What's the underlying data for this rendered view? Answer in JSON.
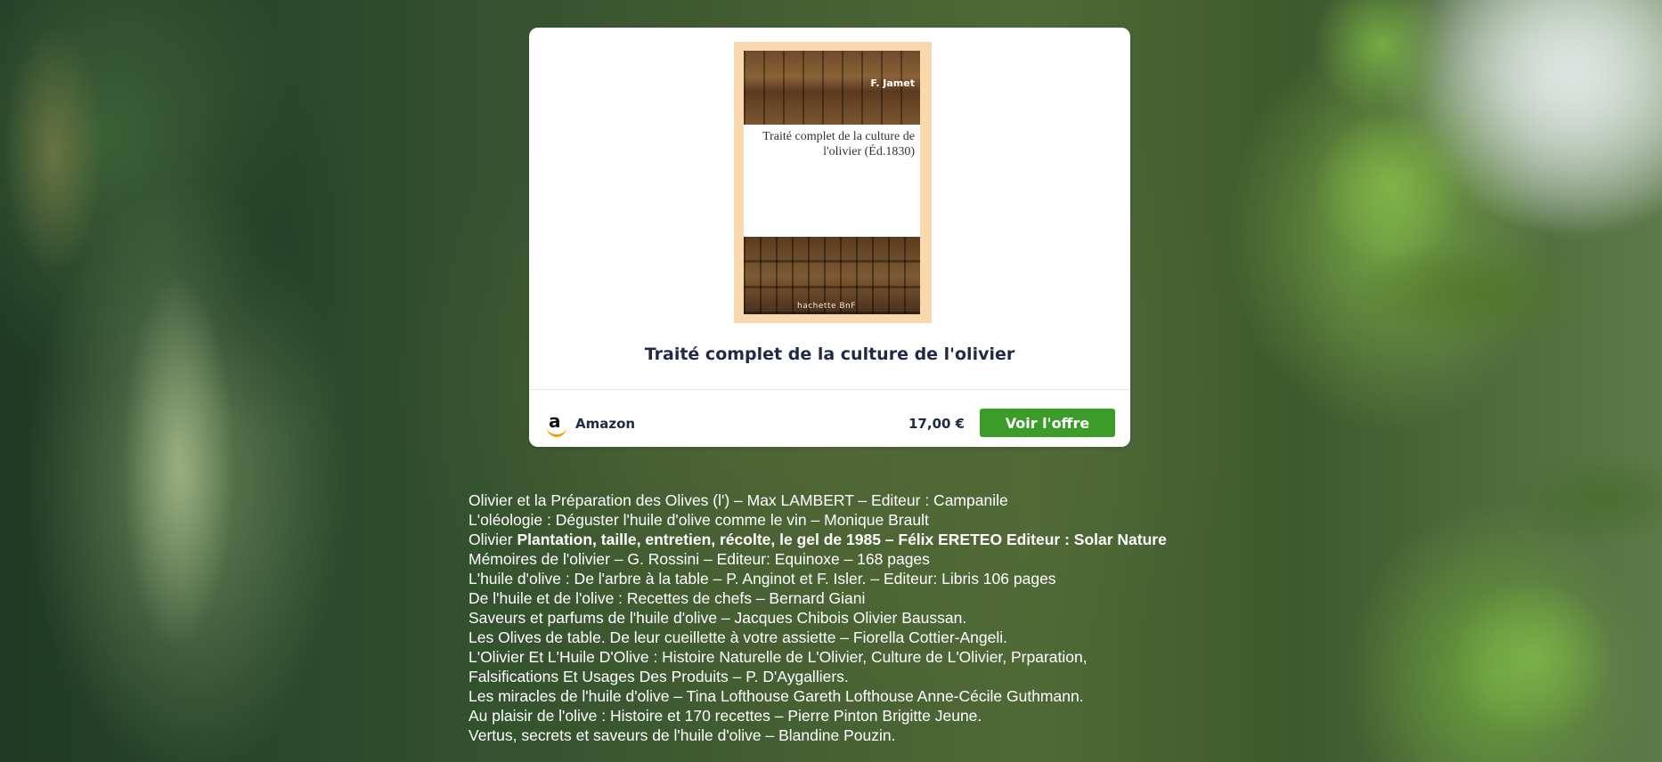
{
  "product_card": {
    "cover": {
      "author": "F. Jamet",
      "title": "Traité complet de la culture de l'olivier (Éd.1830)",
      "publisher": "hachette BnF"
    },
    "title": "Traité complet de la culture de l'olivier",
    "merchant": {
      "icon": "amazon-logo-icon",
      "name": "Amazon"
    },
    "price": "17,00 €",
    "offer_button_label": "Voir l'offre",
    "accent_color": "#3b9c2a"
  },
  "book_list": [
    {
      "text": "Olivier et la Préparation des Olives (l') – Max LAMBERT – Editeur : Campanile"
    },
    {
      "text": "L'oléologie : Déguster l'huile d'olive comme le vin – Monique Brault"
    },
    {
      "prefix": "Olivier ",
      "bold": "Plantation, taille, entretien, récolte, le gel de 1985 – Félix ERETEO Editeur : Solar Nature"
    },
    {
      "text": "Mémoires de l'olivier – G. Rossini – Editeur: Equinoxe – 168 pages"
    },
    {
      "text": "L'huile d'olive : De l'arbre à la table – P. Anginot et F. Isler. – Editeur: Libris 106 pages"
    },
    {
      "text": "De l'huile et de l'olive : Recettes de chefs – Bernard Giani"
    },
    {
      "text": "Saveurs et parfums de l'huile d'olive – Jacques Chibois Olivier Baussan."
    },
    {
      "text": "Les Olives de table. De leur cueillette à votre assiette – Fiorella Cottier-Angeli."
    },
    {
      "text": "L'Olivier Et L'Huile D'Olive : Histoire Naturelle de L'Olivier, Culture de L'Olivier, Prparation, Falsifications Et Usages Des Produits – P. D'Aygalliers."
    },
    {
      "text": "Les miracles de l'huile d'olive – Tina Lofthouse Gareth Lofthouse Anne-Cécile Guthmann."
    },
    {
      "text": "Au plaisir de l'olive : Histoire et 170 recettes – Pierre Pinton Brigitte Jeune."
    },
    {
      "text": "Vertus, secrets et saveurs de l'huile d'olive – Blandine Pouzin."
    }
  ]
}
